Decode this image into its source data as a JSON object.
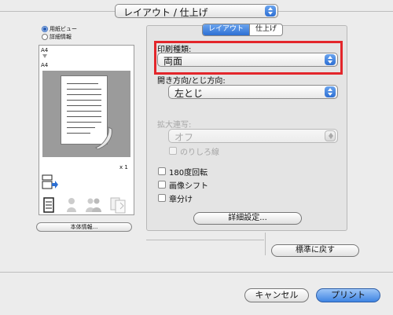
{
  "panel_select": {
    "value": "レイアウト / 仕上げ"
  },
  "view_options": [
    {
      "label": "用紙ビュー",
      "selected": true
    },
    {
      "label": "詳細情報",
      "selected": false
    }
  ],
  "preview": {
    "paper_from": "A4",
    "paper_to": "A4",
    "copies": "x 1",
    "info_button": "本体情報..."
  },
  "tabs": [
    {
      "label": "レイアウト",
      "active": true
    },
    {
      "label": "仕上げ",
      "active": false
    }
  ],
  "layout": {
    "print_type": {
      "label": "印刷種類:",
      "value": "両面"
    },
    "binding": {
      "label": "開き方向/とじ方向:",
      "value": "左とじ"
    },
    "zoom": {
      "label": "拡大連写:",
      "value": "オフ",
      "disabled": true
    },
    "margin_check": {
      "label": "のりしろ線",
      "checked": false,
      "disabled": true
    },
    "rotate180": {
      "label": "180度回転",
      "checked": false
    },
    "image_shift": {
      "label": "画像シフト",
      "checked": false
    },
    "chapter": {
      "label": "章分け",
      "checked": false
    },
    "details_button": "詳細設定..."
  },
  "restore_defaults_button": "標準に戻す",
  "cancel_button": "キャンセル",
  "print_button": "プリント",
  "colors": {
    "accent": "#2d6fd3",
    "highlight": "#e3262b"
  }
}
